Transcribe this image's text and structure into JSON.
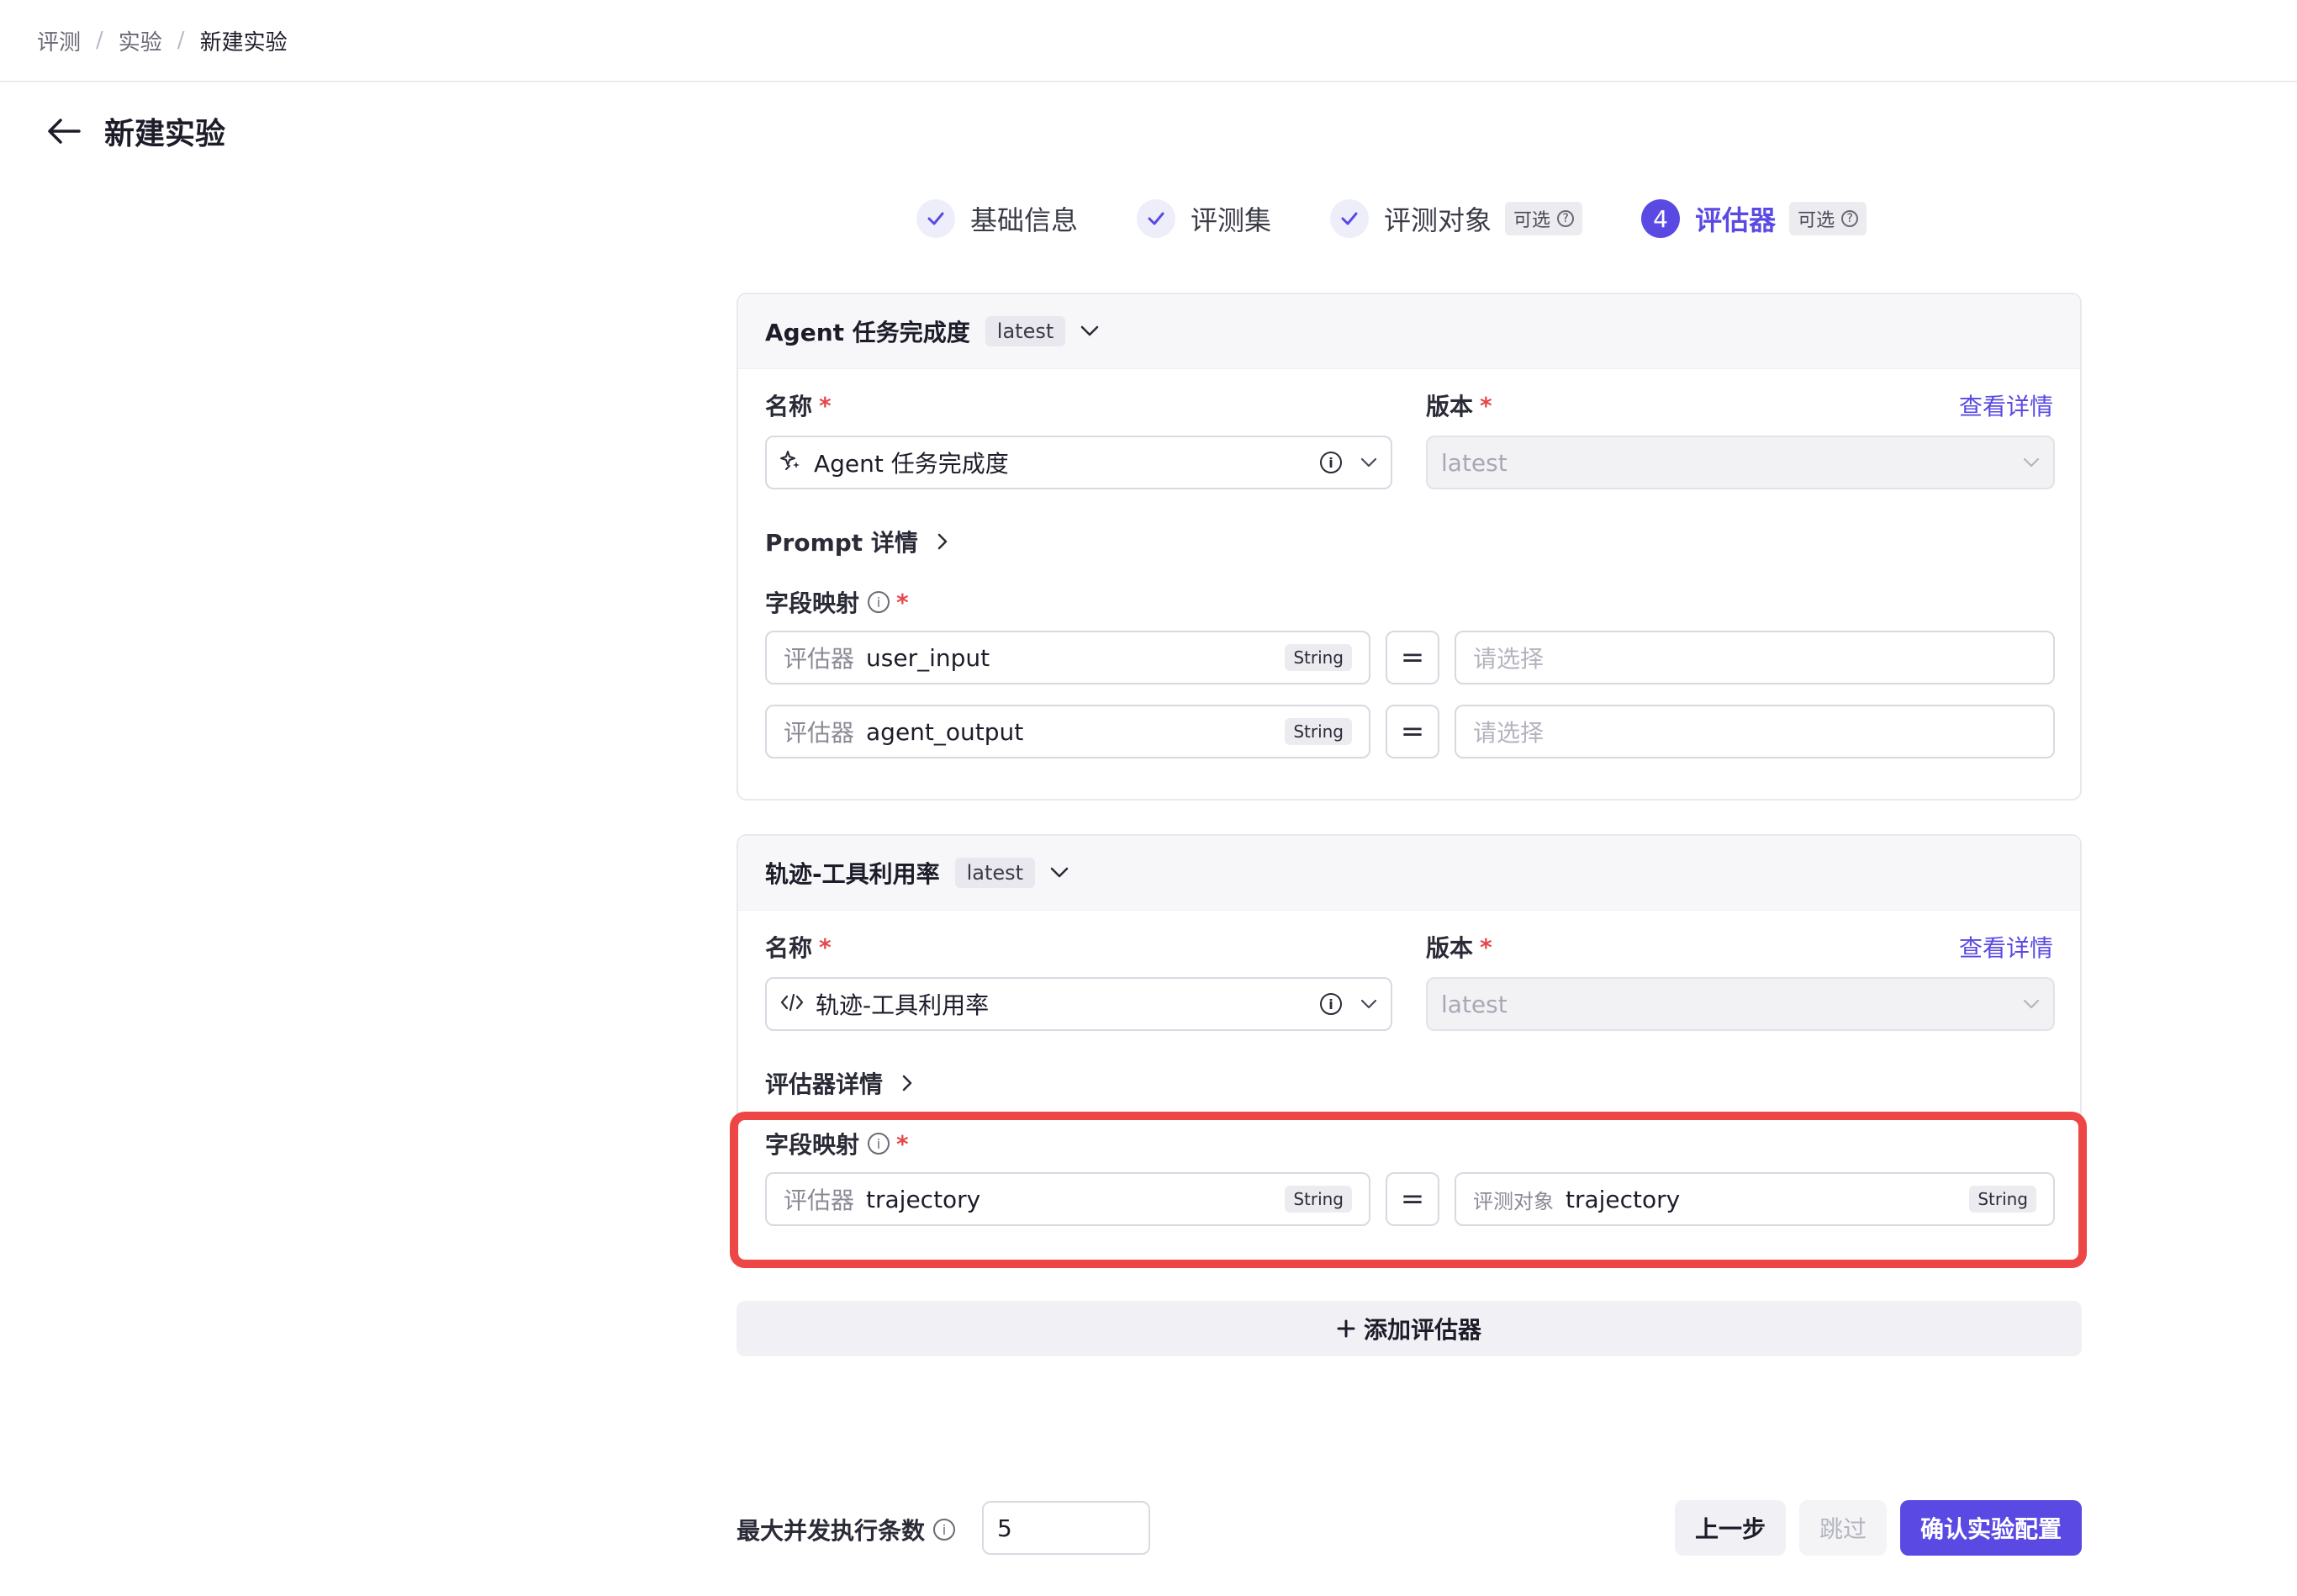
{
  "breadcrumb": [
    "评测",
    "实验",
    "新建实验"
  ],
  "page": {
    "title": "新建实验"
  },
  "steps": [
    {
      "label": "基础信息",
      "state": "done"
    },
    {
      "label": "评测集",
      "state": "done"
    },
    {
      "label": "评测对象",
      "state": "done",
      "tag": "可选"
    },
    {
      "label": "评估器",
      "state": "active",
      "number": "4",
      "tag": "可选"
    }
  ],
  "evaluators": [
    {
      "header": "Agent 任务完成度",
      "version_tag": "latest",
      "name_label": "名称",
      "version_label": "版本",
      "view_details": "查看详情",
      "name_value": "Agent 任务完成度",
      "name_icon": "sparkle-icon",
      "version_value": "latest",
      "details_link": "Prompt 详情",
      "mapping_label": "字段映射",
      "mappings": [
        {
          "prefix": "评估器",
          "field": "user_input",
          "type": "String",
          "target_placeholder": "请选择"
        },
        {
          "prefix": "评估器",
          "field": "agent_output",
          "type": "String",
          "target_placeholder": "请选择"
        }
      ]
    },
    {
      "header": "轨迹-工具利用率",
      "version_tag": "latest",
      "name_label": "名称",
      "version_label": "版本",
      "view_details": "查看详情",
      "name_value": "轨迹-工具利用率",
      "name_icon": "code-icon",
      "version_value": "latest",
      "details_link": "评估器详情",
      "mapping_label": "字段映射",
      "mappings": [
        {
          "prefix": "评估器",
          "field": "trajectory",
          "type": "String",
          "target_prefix": "评测对象",
          "target_field": "trajectory",
          "target_type": "String"
        }
      ]
    }
  ],
  "add_evaluator": "添加评估器",
  "footer": {
    "max_concurrency_label": "最大并发执行条数",
    "max_concurrency_value": "5",
    "prev_button": "上一步",
    "skip_button": "跳过",
    "confirm_button": "确认实验配置"
  },
  "colors": {
    "accent": "#5a4ae3",
    "required": "#e5484d",
    "highlight": "#ee4545"
  }
}
